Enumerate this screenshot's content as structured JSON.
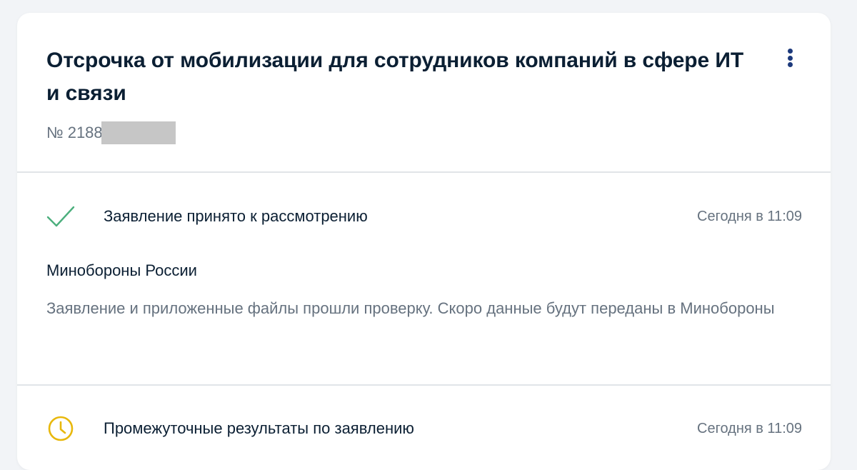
{
  "application": {
    "title": "Отсрочка от мобилизации для сотрудников компаний в сфере ИТ и связи",
    "number_prefix": "№ 2188"
  },
  "statuses": [
    {
      "icon": "checkmark-icon",
      "text": "Заявление принято к рассмотрению",
      "time": "Сегодня в 11:09",
      "organization": "Минобороны России",
      "description": "Заявление и приложенные файлы прошли проверку. Скоро данные будут переданы в Минобороны"
    },
    {
      "icon": "clock-icon",
      "text": "Промежуточные результаты по заявлению",
      "time": "Сегодня в 11:09"
    }
  ],
  "colors": {
    "check": "#4caf7d",
    "clock": "#e8b80c",
    "muted_text": "#66727f",
    "main_text": "#0b1f33",
    "menu_dots": "#1d3a7c"
  }
}
